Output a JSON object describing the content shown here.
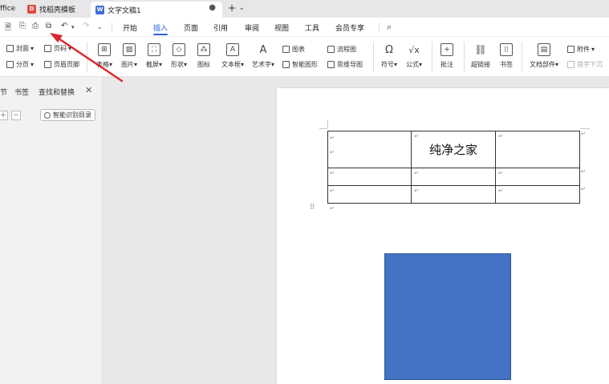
{
  "tabs": {
    "office_label": "ffice",
    "find_template_label": "找稻壳模板",
    "doc_label": "文字文稿1"
  },
  "menubar": {
    "items": [
      "开始",
      "插入",
      "页面",
      "引用",
      "审阅",
      "视图",
      "工具",
      "会员专享"
    ],
    "active": "插入"
  },
  "ribbon": {
    "cover": "封面",
    "page_number": "页码",
    "section": "分页",
    "header_footer": "页眉页脚",
    "table": "表格",
    "picture": "图片",
    "screenshot": "截屏",
    "shape": "形状",
    "icon": "图标",
    "textbox": "文本框",
    "wordart": "艺术字",
    "chart": "图表",
    "smart_graphic": "智能图形",
    "flowchart": "流程图",
    "mindmap": "思维导图",
    "symbol": "符号",
    "formula": "公式",
    "comment": "批注",
    "hyperlink": "超链接",
    "bookmark": "书签",
    "doc_parts": "文档部件",
    "attachment": "附件",
    "drop_cap": "首字下沉"
  },
  "leftpanel": {
    "tab_outline": "节",
    "tab_bookmark": "书签",
    "tab_find_replace": "查找和替换",
    "smart_toc": "智能识别目录"
  },
  "document": {
    "table_cell_text": "纯净之家",
    "shape_color": "#4472c4"
  },
  "colors": {
    "accent": "#2c64d6",
    "arrow": "#d9262b"
  }
}
